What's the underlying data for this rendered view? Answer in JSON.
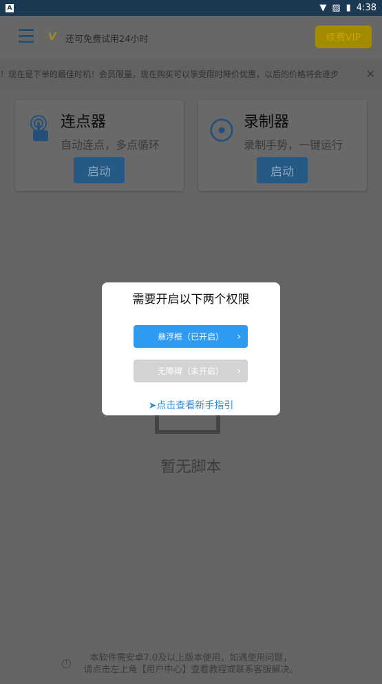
{
  "status_bar": {
    "time": "4:38",
    "app_icon": "A"
  },
  "header": {
    "trial_text": "还可免费试用24小时",
    "renew_label": "续费VIP",
    "vip_logo": "V"
  },
  "notice": {
    "text": "！现在是下单的最佳时机！会员限量，现在购买可以享受限时降价优惠，以后的价格将会逐步"
  },
  "cards": [
    {
      "title": "连点器",
      "desc": "自动连点，多点循环",
      "button": "启动",
      "icon": "tap-hand-icon"
    },
    {
      "title": "录制器",
      "desc": "录制手势，一键运行",
      "button": "启动",
      "icon": "record-icon"
    }
  ],
  "empty": {
    "text": "暂无脚本"
  },
  "footer": {
    "line1": "本软件需安卓7.0及以上版本使用，如遇使用问题，",
    "line2": "请点击左上角【用户中心】查看教程或联系客服解决。"
  },
  "dialog": {
    "title": "需要开启以下两个权限",
    "floating": "悬浮框（已开启）",
    "accessibility": "无障碍（未开启）",
    "guide": "点击查看新手指引"
  },
  "colors": {
    "accent": "#2e9bf0",
    "vip": "#f6c800",
    "primary": "#1f73b7"
  }
}
